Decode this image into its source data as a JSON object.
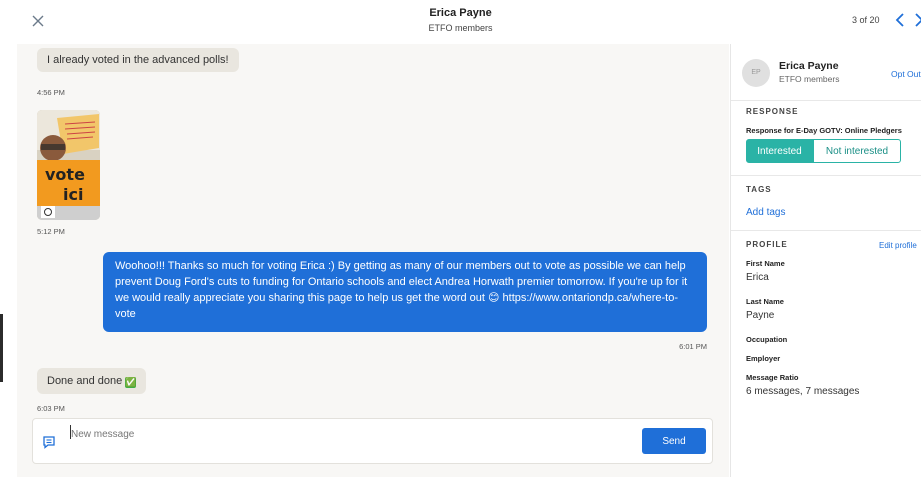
{
  "header": {
    "contact_name": "Erica Payne",
    "group": "ETFO members",
    "pager": "3 of 20"
  },
  "messages": {
    "m1_text": "I already voted in the advanced polls!",
    "m1_time": "4:56 PM",
    "m2_time": "5:12 PM",
    "m2_image_text": [
      "vote",
      "ici"
    ],
    "m3_text": "Woohoo!!! Thanks so much for voting Erica :) By getting as many of our members out to vote as possible we can help prevent Doug Ford's cuts to funding for Ontario schools and elect Andrea Horwath premier tomorrow. If you're up for it we would really appreciate you sharing this page to help us get the word out 😊 https://www.ontariondp.ca/where-to-vote",
    "m3_time": "6:01 PM",
    "m4_text": "Done and done",
    "m4_emoji": "✅",
    "m4_time": "6:03 PM"
  },
  "composer": {
    "placeholder": "New message",
    "send_label": "Send"
  },
  "panel": {
    "avatar_initials": "EP",
    "name": "Erica Payne",
    "group": "ETFO members",
    "opt_out_label": "Opt Out",
    "response_title": "RESPONSE",
    "response_question": "Response for E-Day GOTV: Online Pledgers",
    "interested_label": "Interested",
    "not_interested_label": "Not interested",
    "selected_response": "Interested",
    "tags_title": "TAGS",
    "add_tags_label": "Add tags",
    "profile_title": "PROFILE",
    "edit_profile_label": "Edit profile",
    "fields": {
      "first_name_label": "First Name",
      "first_name_value": "Erica",
      "last_name_label": "Last Name",
      "last_name_value": "Payne",
      "occupation_label": "Occupation",
      "employer_label": "Employer",
      "message_ratio_label": "Message Ratio",
      "message_ratio_value": "6 messages, 7 messages"
    }
  },
  "colors": {
    "accent_blue": "#1f6fd8",
    "teal": "#2ab3a6",
    "chat_bg": "#f8f7f5",
    "incoming_bubble": "#e9e6df"
  }
}
